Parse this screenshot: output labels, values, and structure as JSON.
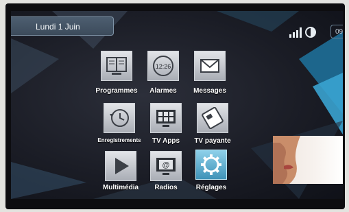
{
  "header": {
    "date": "Lundi 1 Juin",
    "clock_partial": "09"
  },
  "menu": {
    "items": [
      {
        "label": "Programmes",
        "icon": "book-icon"
      },
      {
        "label": "Alarmes",
        "icon": "clock-icon",
        "icon_text": "12:26"
      },
      {
        "label": "Messages",
        "icon": "envelope-icon"
      },
      {
        "label": "Enregistrements",
        "icon": "history-icon"
      },
      {
        "label": "TV Apps",
        "icon": "tv-apps-icon"
      },
      {
        "label": "TV payante",
        "icon": "card-icon"
      },
      {
        "label": "Multimédia",
        "icon": "play-icon"
      },
      {
        "label": "Radios",
        "icon": "radio-icon"
      },
      {
        "label": "Réglages",
        "icon": "gear-icon",
        "selected": true
      }
    ]
  },
  "colors": {
    "accent": "#3f93b8",
    "background": "#1b1d26",
    "date_bar": "#4d5e70"
  }
}
